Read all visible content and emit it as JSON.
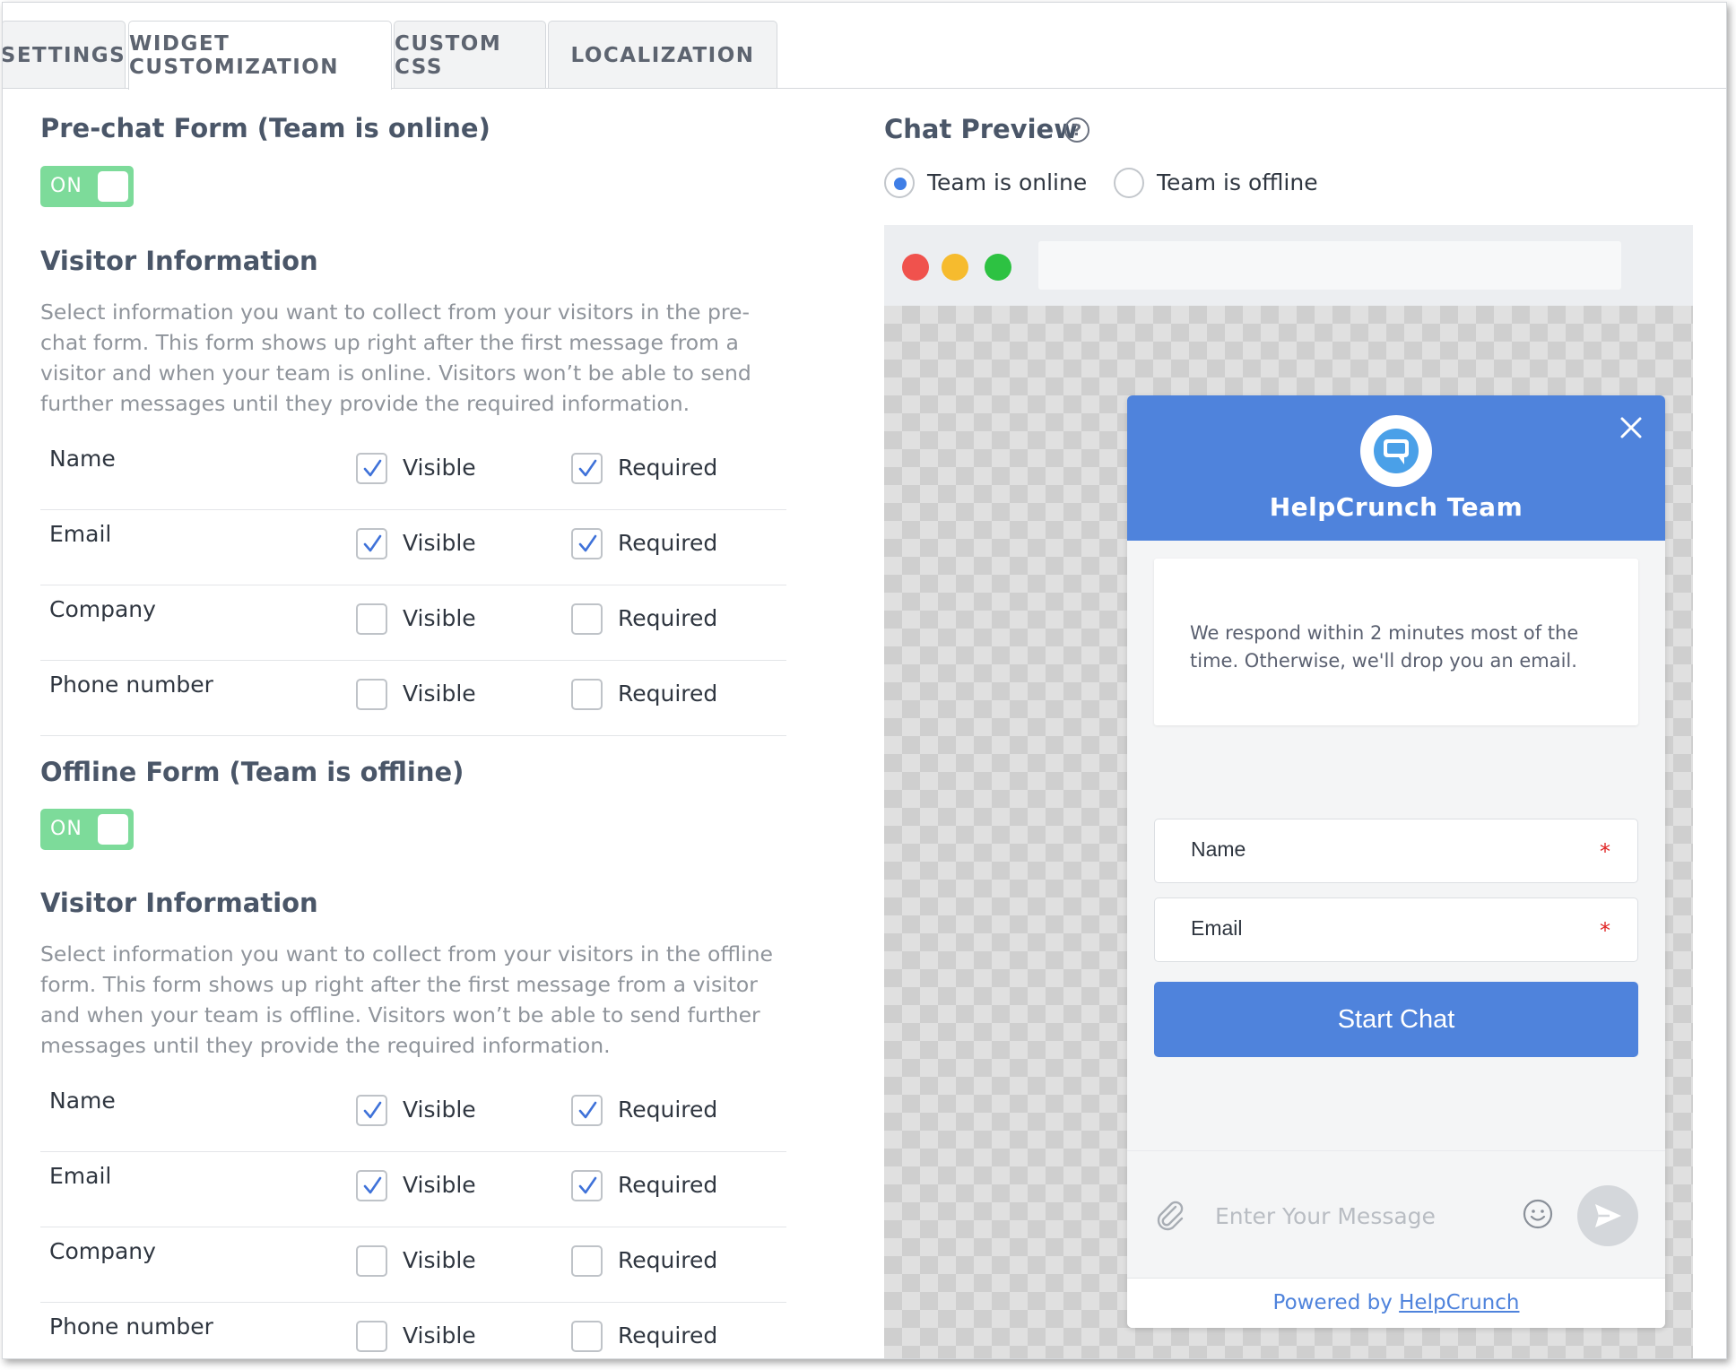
{
  "tabs": [
    {
      "label": "SETTINGS"
    },
    {
      "label": "WIDGET CUSTOMIZATION",
      "active": true
    },
    {
      "label": "CUSTOM CSS"
    },
    {
      "label": "LOCALIZATION"
    }
  ],
  "prechat": {
    "title": "Pre-chat Form (Team is online)",
    "toggle": "ON",
    "section_title": "Visitor Information",
    "description": "Select information you want to collect from your visitors in the pre-chat form. This form shows up right after the first message from a visitor and when your team is online. Visitors won’t be able to send further messages until they provide the required information.",
    "fields": [
      {
        "name": "Name",
        "visible": true,
        "required": true
      },
      {
        "name": "Email",
        "visible": true,
        "required": true
      },
      {
        "name": "Company",
        "visible": false,
        "required": false
      },
      {
        "name": "Phone number",
        "visible": false,
        "required": false
      }
    ]
  },
  "offline": {
    "title": "Offline Form (Team is offline)",
    "toggle": "ON",
    "section_title": "Visitor Information",
    "description": "Select information you want to collect from your visitors in the offline form. This form shows up right after the first message from a visitor and when your team is offline. Visitors won’t be able to send further messages until they provide the required information.",
    "fields": [
      {
        "name": "Name",
        "visible": true,
        "required": true
      },
      {
        "name": "Email",
        "visible": true,
        "required": true
      },
      {
        "name": "Company",
        "visible": false,
        "required": false
      },
      {
        "name": "Phone number",
        "visible": false,
        "required": false
      }
    ]
  },
  "labels": {
    "visible": "Visible",
    "required": "Required"
  },
  "preview": {
    "title": "Chat Preview",
    "help": "?",
    "radios": [
      {
        "label": "Team is online",
        "selected": true
      },
      {
        "label": "Team is offline",
        "selected": false
      }
    ]
  },
  "widget": {
    "team_name": "HelpCrunch Team",
    "message": "We respond within 2 minutes most of the time. Otherwise, we'll drop you an email.",
    "inputs": [
      {
        "label": "Name",
        "required_mark": "*"
      },
      {
        "label": "Email",
        "required_mark": "*"
      }
    ],
    "start_button": "Start Chat",
    "message_placeholder": "Enter Your Message",
    "footer_prefix": "Powered by",
    "footer_link": "HelpCrunch"
  },
  "colors": {
    "accent": "#4f83dc",
    "toggle_on": "#7ddb9a",
    "required": "#e02424",
    "traffic_red": "#f0524d",
    "traffic_yellow": "#f6bb2e",
    "traffic_green": "#2dc242"
  }
}
